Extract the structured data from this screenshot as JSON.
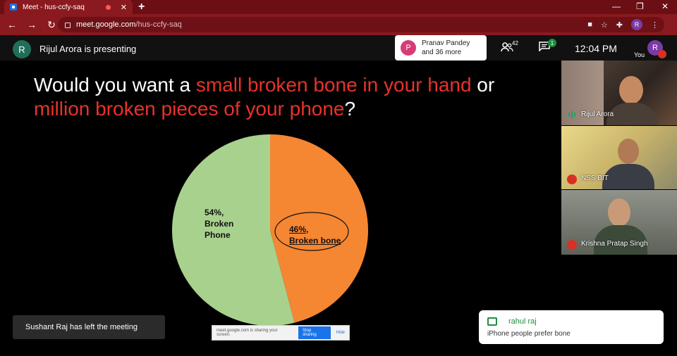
{
  "browser": {
    "tab_title": "Meet - hus-ccfy-saq",
    "url_host": "meet.google.com",
    "url_path": "/hus-ccfy-saq",
    "profile_initial": "R"
  },
  "meet_bar": {
    "presenter_initial": "R",
    "presenting_text": "Rijul Arora is presenting",
    "people_initial": "P",
    "people_line1": "Pranav Pandey",
    "people_line2": "and 36 more",
    "participant_count": "42",
    "chat_badge": "1",
    "time": "12:04  PM",
    "you_label": "You",
    "self_initial": "R"
  },
  "slide": {
    "title_part1": "Would you want a ",
    "title_highlight1": "small broken bone in your hand",
    "title_part2": " or",
    "title_highlight2": "million broken pieces of your phone",
    "title_part3": "?",
    "green_label_line1": "54%,",
    "green_label_line2": "Broken",
    "green_label_line3": "Phone",
    "orange_label_line1": "46%,",
    "orange_label_line2": "Broken bone"
  },
  "chart_data": {
    "type": "pie",
    "title": "",
    "slices": [
      {
        "label": "Broken Phone",
        "value": 54,
        "color": "#a9d18e"
      },
      {
        "label": "Broken bone",
        "value": 46,
        "color": "#f58632"
      }
    ]
  },
  "participants": [
    {
      "name": "Rijul Arora",
      "mic": "on"
    },
    {
      "name": "NSS BIT",
      "mic": "off"
    },
    {
      "name": "Krishna Pratap Singh",
      "mic": "off"
    }
  ],
  "notifications": {
    "left_meeting": "Sushant Raj has left the meeting",
    "chat_sender": "rahul raj",
    "chat_message": "iPhone people prefer bone"
  },
  "share_bar": {
    "message": "meet.google.com is sharing your screen.",
    "stop_label": "Stop sharing",
    "hide_label": "Hide"
  }
}
